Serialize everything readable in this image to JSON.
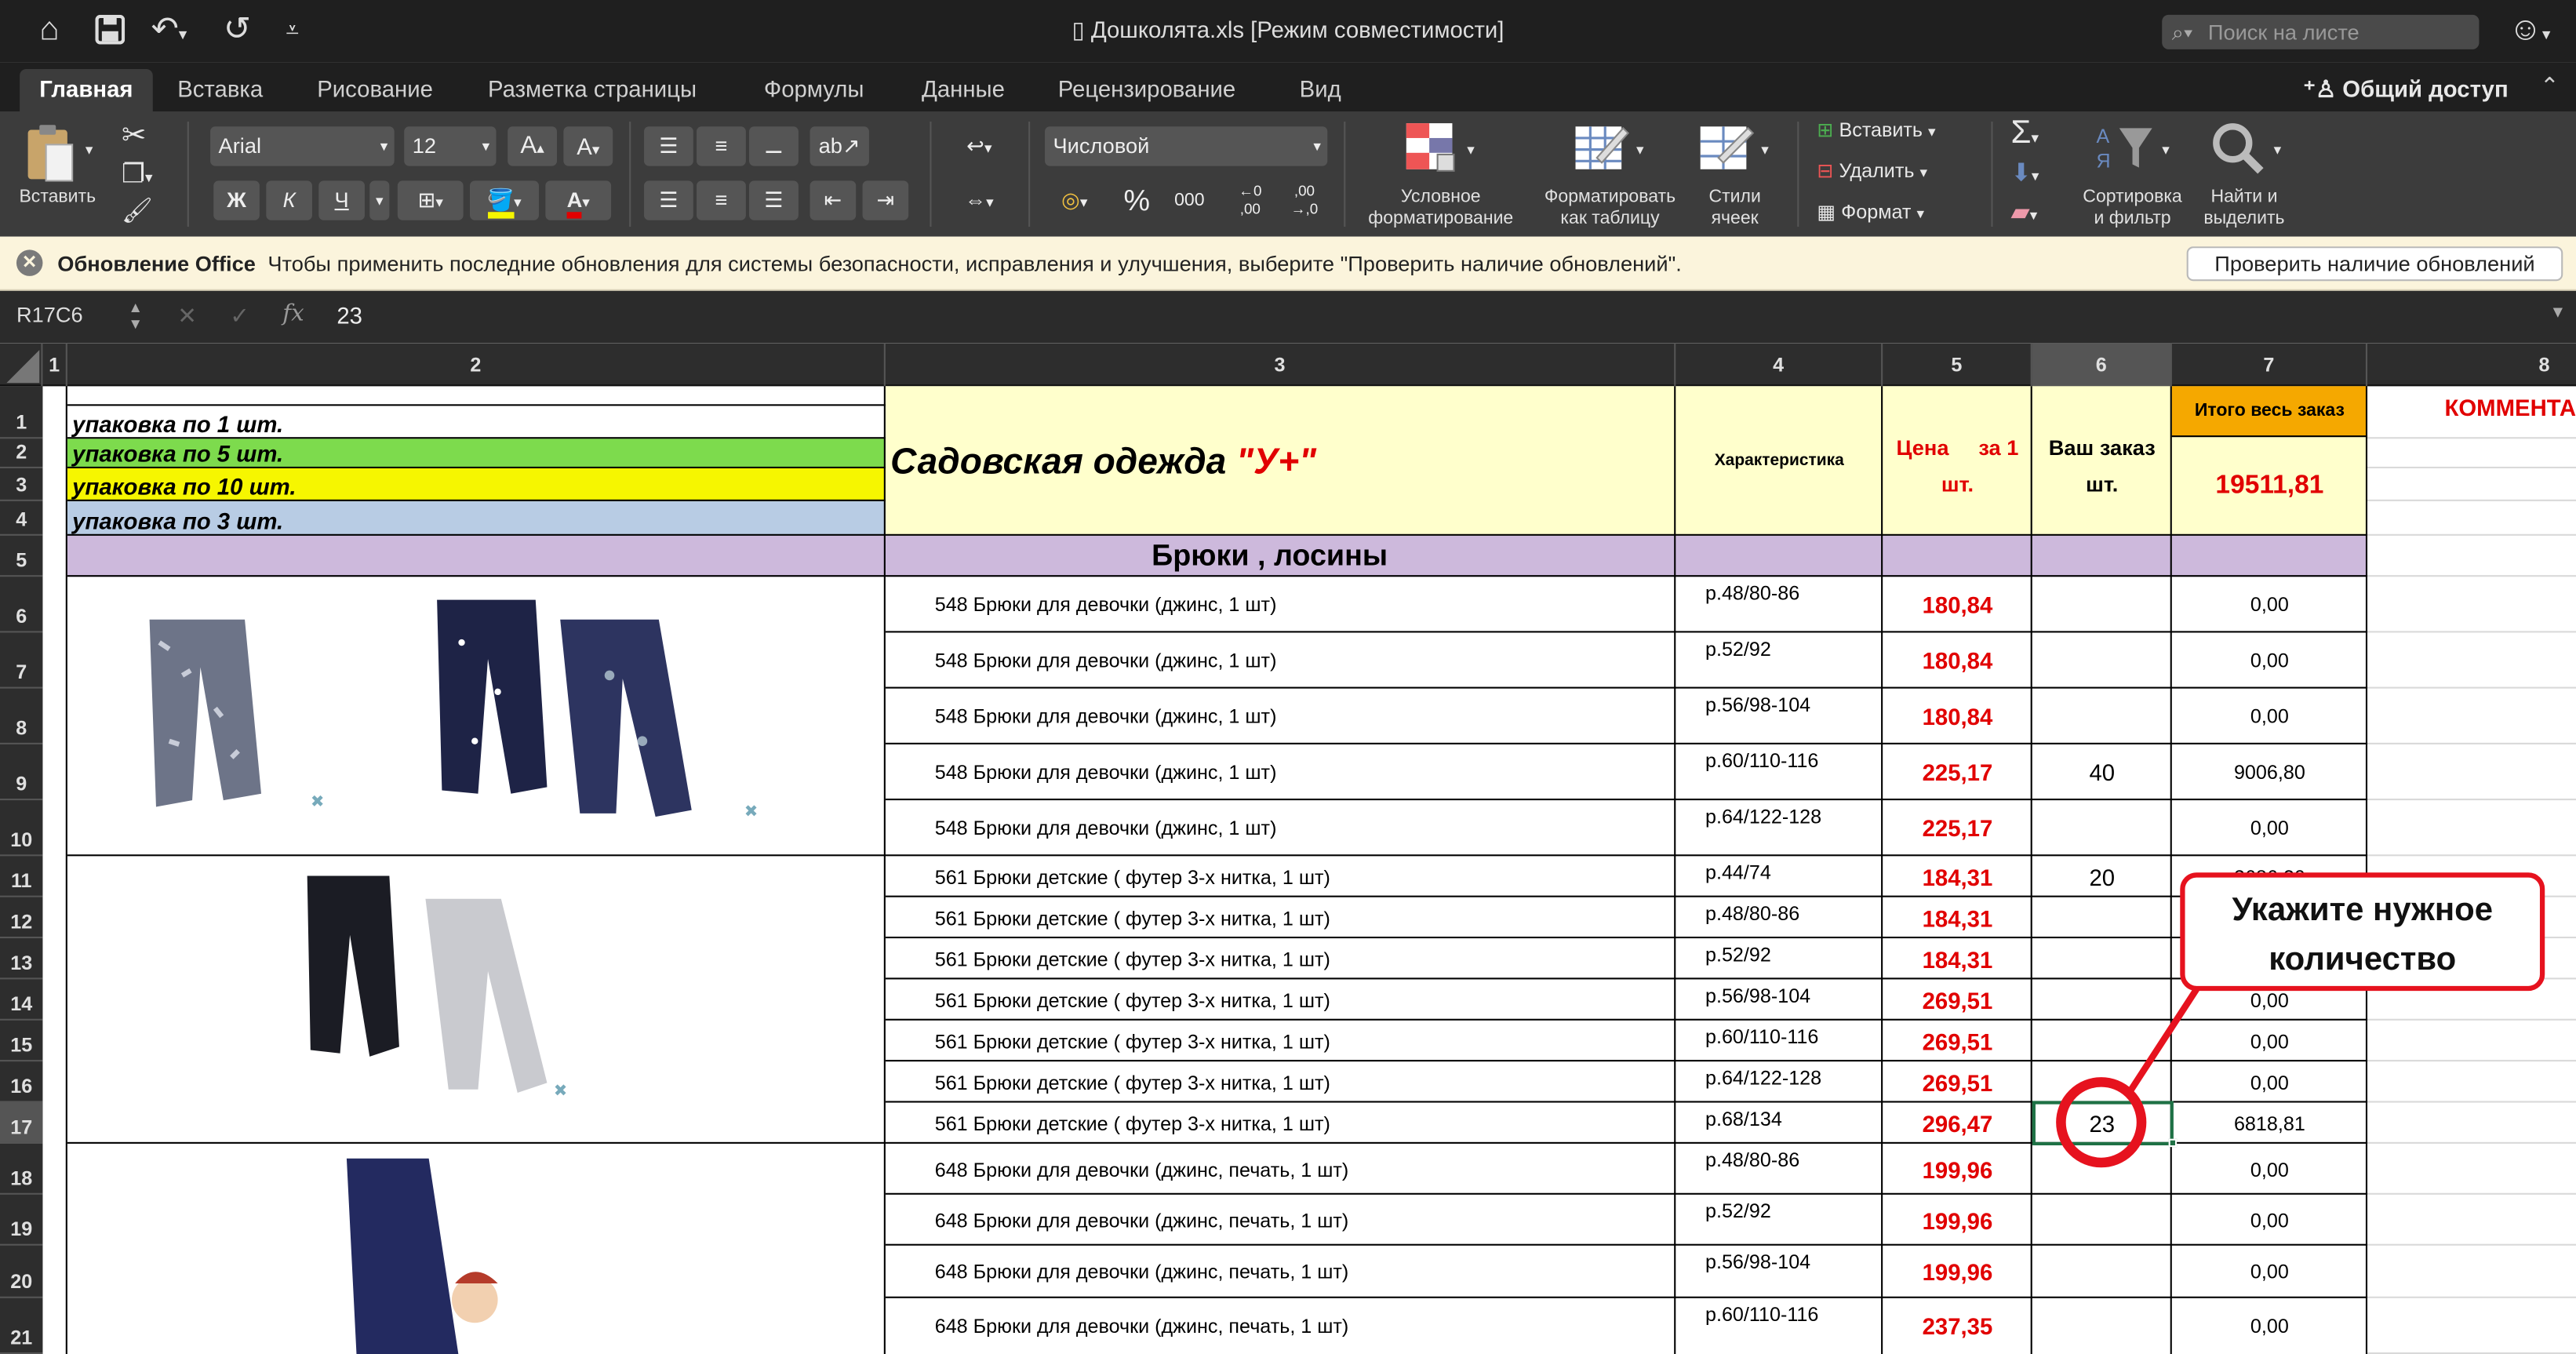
{
  "window": {
    "title": "Дошколята.xls  [Режим совместимости]",
    "search_placeholder": "Поиск на листе"
  },
  "tabs": [
    {
      "label": "Главная",
      "active": true
    },
    {
      "label": "Вставка"
    },
    {
      "label": "Рисование"
    },
    {
      "label": "Разметка страницы"
    },
    {
      "label": "Формулы"
    },
    {
      "label": "Данные"
    },
    {
      "label": "Рецензирование"
    },
    {
      "label": "Вид"
    }
  ],
  "share_label": "Общий доступ",
  "ribbon": {
    "paste_label": "Вставить",
    "font_name": "Arial",
    "font_size": "12",
    "bold": "Ж",
    "italic": "К",
    "underline": "Ч",
    "number_format": "Числовой",
    "percent": "%",
    "thousands": "000",
    "cond_format": [
      "Условное",
      "форматирование"
    ],
    "format_table": [
      "Форматировать",
      "как таблицу"
    ],
    "cell_styles": [
      "Стили",
      "ячеек"
    ],
    "insert_cells": "Вставить",
    "delete_cells": "Удалить",
    "format_cells": "Формат",
    "sort_filter": [
      "Сортировка",
      "и фильтр"
    ],
    "find_select": [
      "Найти и",
      "выделить"
    ]
  },
  "notification": {
    "title": "Обновление Office",
    "message": "Чтобы применить последние обновления для системы безопасности, исправления и улучшения, выберите \"Проверить наличие обновлений\".",
    "button": "Проверить наличие обновлений"
  },
  "formula_bar": {
    "name_box": "R17C6",
    "fx": "fx",
    "value": "23"
  },
  "columns": [
    "1",
    "2",
    "3",
    "4",
    "5",
    "6",
    "7",
    "8"
  ],
  "rows": [
    "1",
    "2",
    "3",
    "4",
    "5",
    "6",
    "7",
    "8",
    "9",
    "10",
    "11",
    "12",
    "13",
    "14",
    "15",
    "16",
    "17",
    "18",
    "19",
    "20",
    "21"
  ],
  "selected_cell": "R17C6",
  "legend": [
    {
      "label": "упаковка по 1 шт.",
      "color": "#ffffff"
    },
    {
      "label": "упаковка по 5 шт.",
      "color": "#7ddb4d"
    },
    {
      "label": "упаковка по 10 шт.",
      "color": "#f6f600"
    },
    {
      "label": "упаковка по 3 шт.",
      "color": "#b8cce4"
    }
  ],
  "header": {
    "brand_prefix": "Садовская одежда ",
    "brand_mark": "\"У+\"",
    "characteristic": "Характеристика",
    "price_line1": "Цена     за 1",
    "price_line2": "шт.",
    "order_line1": "Ваш заказ",
    "order_line2": "шт.",
    "total_label": "Итого весь заказ",
    "total_value": "19511,81",
    "comments": "КОММЕНТА"
  },
  "section_title": "Брюки , лосины",
  "colors": {
    "accent_red": "#e10000",
    "header_yellow": "#ffffcc",
    "total_orange": "#f5a800",
    "section_lavender": "#cdb9dc",
    "callout_red": "#e6121e",
    "selection_green": "#1e7145"
  },
  "items": [
    {
      "name": "548 Брюки для девочки (джинс, 1 шт)",
      "size": "р.48/80-86",
      "price": "180,84",
      "qty": "",
      "total": "0,00"
    },
    {
      "name": "548 Брюки для девочки (джинс, 1 шт)",
      "size": "р.52/92",
      "price": "180,84",
      "qty": "",
      "total": "0,00"
    },
    {
      "name": "548 Брюки для девочки (джинс, 1 шт)",
      "size": "р.56/98-104",
      "price": "180,84",
      "qty": "",
      "total": "0,00"
    },
    {
      "name": "548 Брюки для девочки (джинс, 1 шт)",
      "size": "р.60/110-116",
      "price": "225,17",
      "qty": "40",
      "total": "9006,80"
    },
    {
      "name": "548 Брюки для девочки (джинс, 1 шт)",
      "size": "р.64/122-128",
      "price": "225,17",
      "qty": "",
      "total": "0,00"
    },
    {
      "name": "561 Брюки детские ( футер 3-х нитка, 1 шт)",
      "size": "р.44/74",
      "price": "184,31",
      "qty": "20",
      "total": "3686,20"
    },
    {
      "name": "561 Брюки детские ( футер 3-х нитка, 1 шт)",
      "size": "р.48/80-86",
      "price": "184,31",
      "qty": "",
      "total": "0,00"
    },
    {
      "name": "561 Брюки детские ( футер 3-х нитка, 1 шт)",
      "size": "р.52/92",
      "price": "184,31",
      "qty": "",
      "total": "0,00"
    },
    {
      "name": "561 Брюки детские ( футер 3-х нитка, 1 шт)",
      "size": "р.56/98-104",
      "price": "269,51",
      "qty": "",
      "total": "0,00"
    },
    {
      "name": "561 Брюки детские ( футер 3-х нитка, 1 шт)",
      "size": "р.60/110-116",
      "price": "269,51",
      "qty": "",
      "total": "0,00"
    },
    {
      "name": "561 Брюки детские ( футер 3-х нитка, 1 шт)",
      "size": "р.64/122-128",
      "price": "269,51",
      "qty": "",
      "total": "0,00"
    },
    {
      "name": "561 Брюки детские ( футер 3-х нитка, 1 шт)",
      "size": "р.68/134",
      "price": "296,47",
      "qty": "23",
      "total": "6818,81"
    },
    {
      "name": "648 Брюки для девочки (джинс, печать, 1 шт)",
      "size": "р.48/80-86",
      "price": "199,96",
      "qty": "",
      "total": "0,00"
    },
    {
      "name": "648 Брюки для девочки (джинс, печать, 1 шт)",
      "size": "р.52/92",
      "price": "199,96",
      "qty": "",
      "total": "0,00"
    },
    {
      "name": "648 Брюки для девочки (джинс, печать, 1 шт)",
      "size": "р.56/98-104",
      "price": "199,96",
      "qty": "",
      "total": "0,00"
    },
    {
      "name": "648 Брюки для девочки (джинс, печать, 1 шт)",
      "size": "р.60/110-116",
      "price": "237,35",
      "qty": "",
      "total": "0,00"
    }
  ],
  "callout": {
    "line1": "Укажите нужное",
    "line2": "количество"
  }
}
